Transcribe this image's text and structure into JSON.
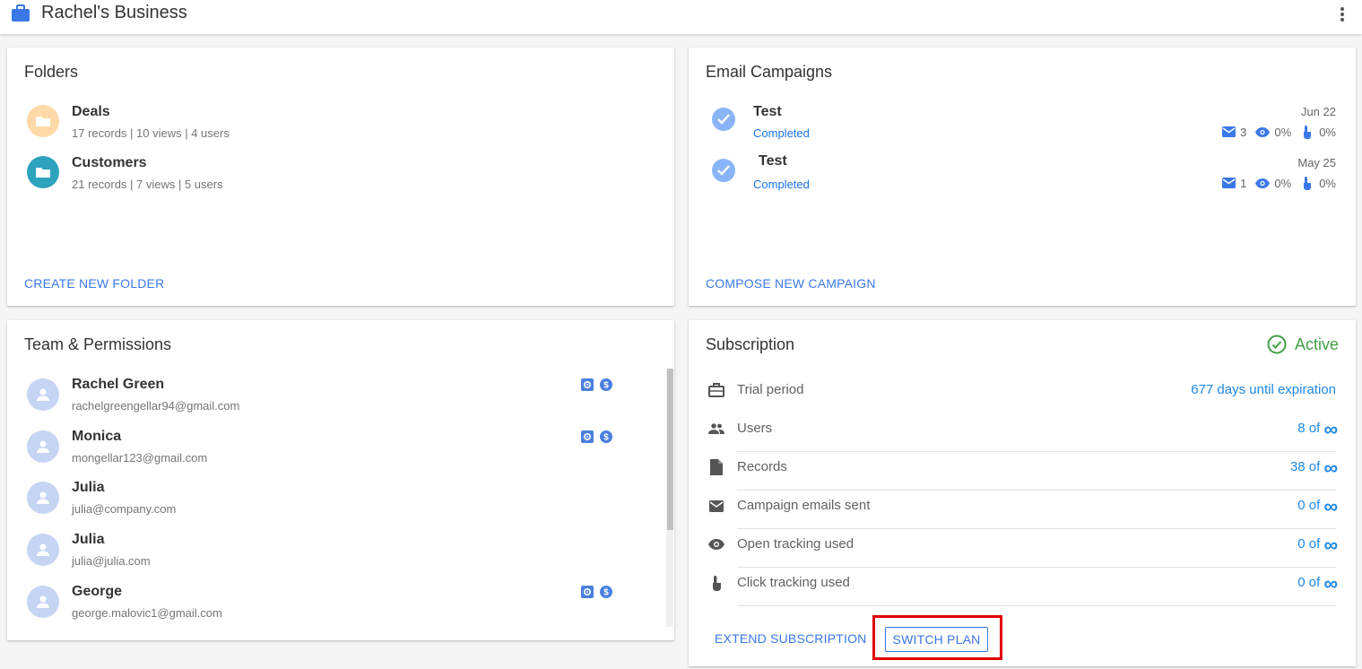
{
  "header": {
    "title": "Rachel's Business",
    "brand_icon": "briefcase-icon",
    "menu_icon": "more-vert-icon"
  },
  "folders": {
    "title": "Folders",
    "items": [
      {
        "name": "Deals",
        "meta": "17 records | 10 views | 4 users",
        "color": "#ffd9a8"
      },
      {
        "name": "Customers",
        "meta": "21 records | 7 views | 5 users",
        "color": "#2ea3bd"
      }
    ],
    "action": "CREATE NEW FOLDER"
  },
  "campaigns": {
    "title": "Email Campaigns",
    "items": [
      {
        "name": "Test",
        "status": "Completed",
        "date": "Jun 22",
        "sent": "3",
        "opens": "0%",
        "clicks": "0%"
      },
      {
        "name": "Test",
        "status": "Completed",
        "date": "May 25",
        "sent": "1",
        "opens": "0%",
        "clicks": "0%"
      }
    ],
    "action": "COMPOSE NEW CAMPAIGN"
  },
  "team": {
    "title": "Team & Permissions",
    "members": [
      {
        "name": "Rachel Green",
        "email": "rachelgreengellar94@gmail.com",
        "admin": true
      },
      {
        "name": "Monica",
        "email": "mongellar123@gmail.com",
        "admin": true
      },
      {
        "name": "Julia",
        "email": "julia@company.com",
        "admin": false
      },
      {
        "name": "Julia",
        "email": "julia@julia.com",
        "admin": false
      },
      {
        "name": "George",
        "email": "george.malovic1@gmail.com",
        "admin": true
      }
    ]
  },
  "subscription": {
    "title": "Subscription",
    "status": "Active",
    "rows": [
      {
        "icon": "briefcase-icon",
        "label": "Trial period",
        "value": "677 days until expiration",
        "infinite": false
      },
      {
        "icon": "people-icon",
        "label": "Users",
        "value": "8 of",
        "infinite": true
      },
      {
        "icon": "document-icon",
        "label": "Records",
        "value": "38 of",
        "infinite": true
      },
      {
        "icon": "envelope-icon",
        "label": "Campaign emails sent",
        "value": "0 of",
        "infinite": true
      },
      {
        "icon": "eye-icon",
        "label": "Open tracking used",
        "value": "0 of",
        "infinite": true
      },
      {
        "icon": "touch-icon",
        "label": "Click tracking used",
        "value": "0 of",
        "infinite": true
      }
    ],
    "infinity_symbol": "∞",
    "extend_label": "EXTEND SUBSCRIPTION",
    "switch_label": "SWITCH PLAN"
  },
  "colors": {
    "accent": "#3b78e7",
    "active": "#43a047",
    "highlight": "#e00000"
  }
}
